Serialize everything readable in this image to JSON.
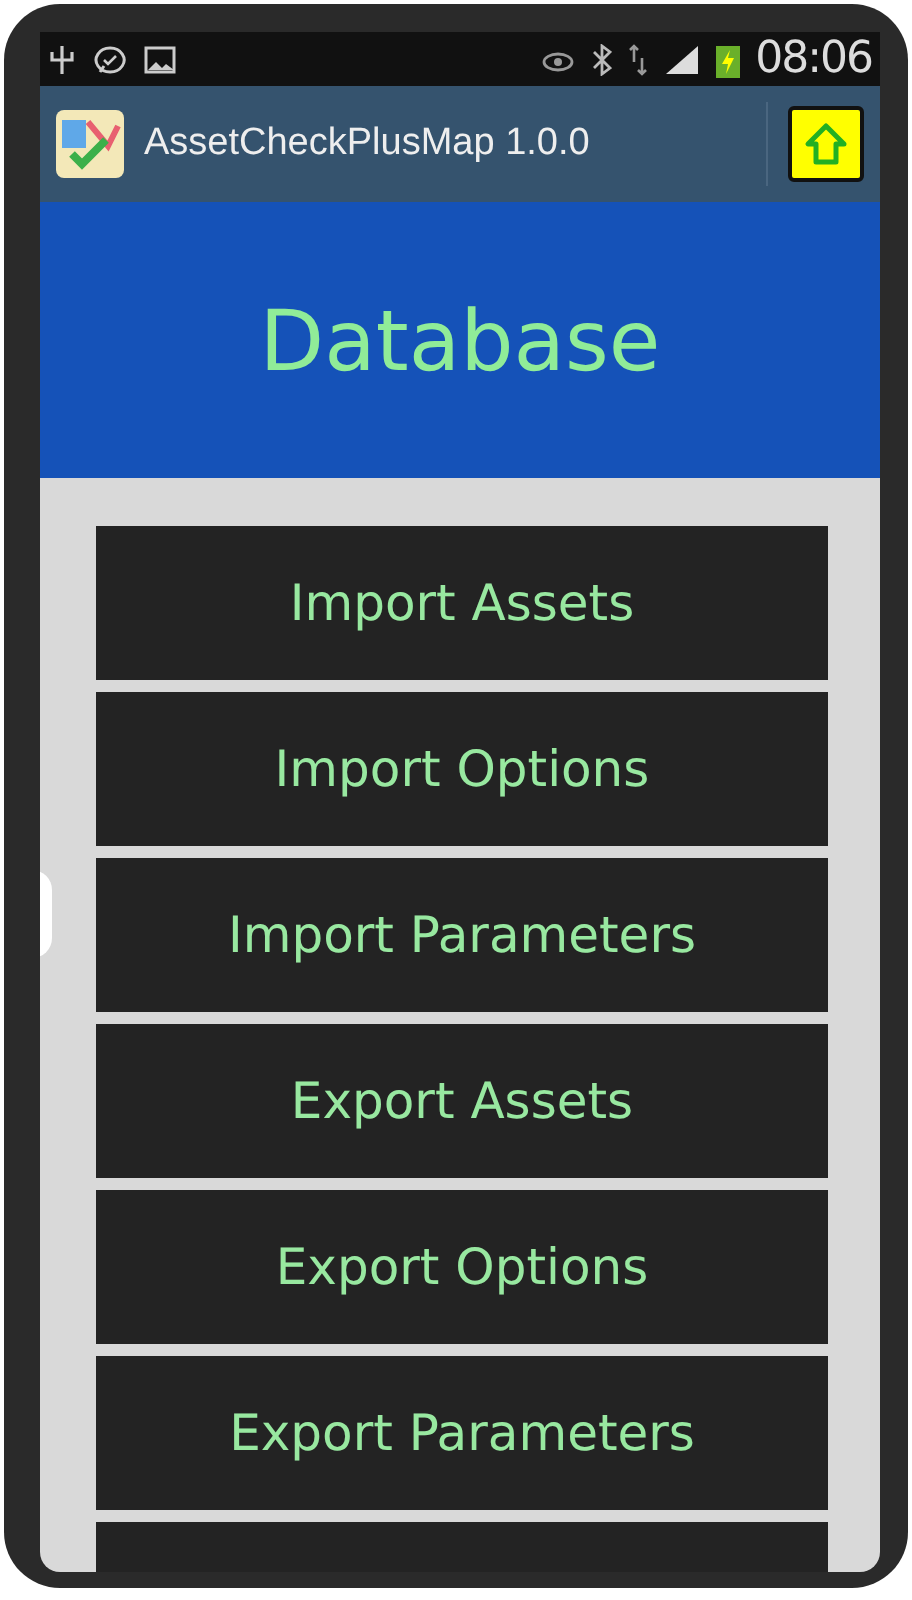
{
  "status_bar": {
    "time": "08:06"
  },
  "action_bar": {
    "title": "AssetCheckPlusMap 1.0.0"
  },
  "header": {
    "title": "Database"
  },
  "buttons": [
    {
      "kind": "label",
      "label": "Import Assets"
    },
    {
      "kind": "label",
      "label": "Import Options"
    },
    {
      "kind": "label",
      "label": "Import Parameters"
    },
    {
      "kind": "label",
      "label": "Export Assets"
    },
    {
      "kind": "label",
      "label": "Export Options"
    },
    {
      "kind": "label",
      "label": "Export Parameters"
    },
    {
      "kind": "partial"
    }
  ]
}
